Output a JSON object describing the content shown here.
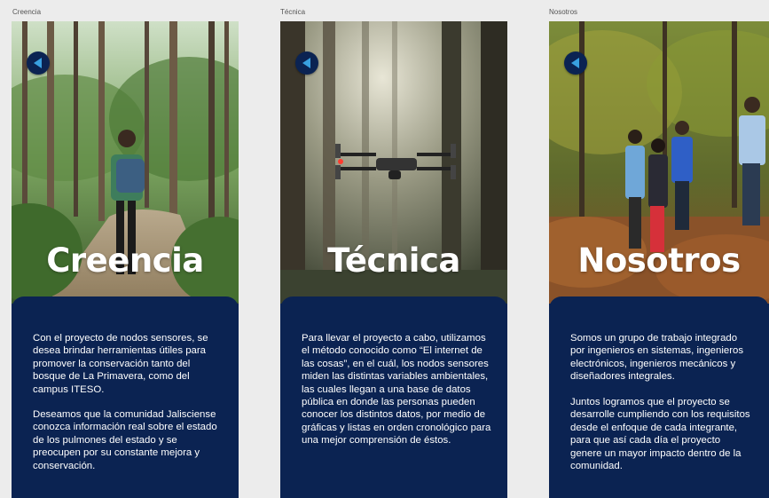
{
  "frames": [
    {
      "frame_label": "Creencia",
      "title": "Creencia",
      "paragraphs": [
        "Con el proyecto de nodos sensores, se desea brindar herramientas útiles para promover la conservación tanto del bosque de La Primavera, como del campus ITESO.",
        "Deseamos que la comunidad Jalisciense conozca información real sobre el estado de los pulmones del estado y se preocupen por su constante mejora y conservación."
      ]
    },
    {
      "frame_label": "Técnica",
      "title": "Técnica",
      "paragraphs": [
        "Para llevar el proyecto a cabo, utilizamos el método conocido como “El internet de las cosas”, en el cuál, los nodos sensores miden las distintas variables ambientales, las cuales llegan a una base de datos pública en donde las personas pueden conocer los distintos datos, por medio de gráficas y listas en orden cronológico para una mejor comprensión de éstos."
      ]
    },
    {
      "frame_label": "Nosotros",
      "title": "Nosotros",
      "paragraphs": [
        "Somos un grupo de trabajo integrado por ingenieros en sistemas, ingenieros electrónicos, ingenieros mecánicos y diseñadores integrales.",
        "Juntos logramos que el proyecto se desarrolle cumpliendo con los requisitos desde el enfoque de cada integrante, para que así cada día el proyecto genere un mayor impacto dentro de la comunidad."
      ]
    }
  ],
  "icons": {
    "back": "back-arrow-icon"
  },
  "colors": {
    "card_background": "#0b2352",
    "canvas_background": "#ececec",
    "text": "#ffffff"
  }
}
